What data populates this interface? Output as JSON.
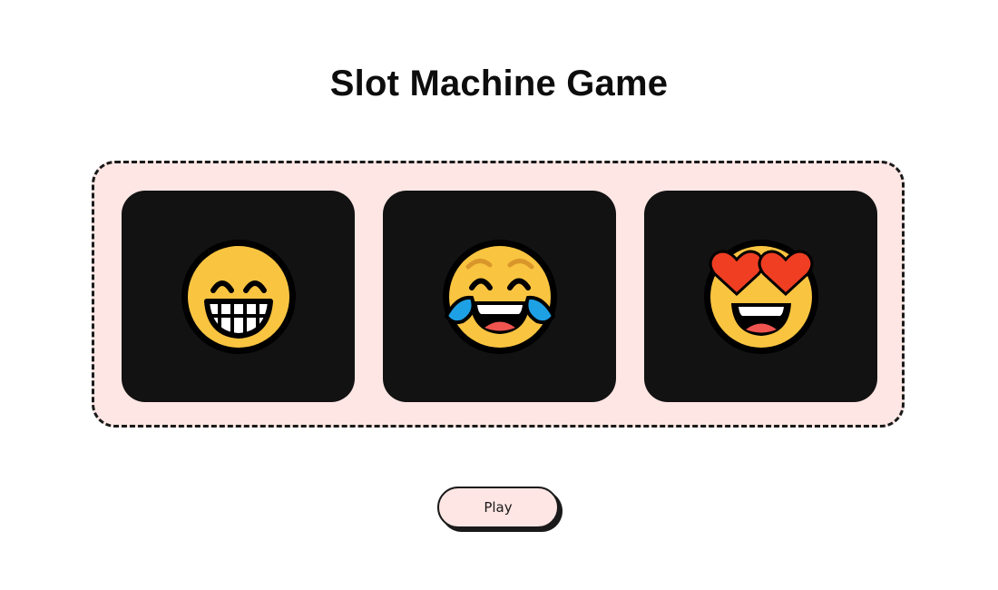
{
  "game": {
    "title": "Slot Machine Game",
    "play_label": "Play"
  },
  "reels": [
    {
      "symbol": "grinning-face-with-smiling-eyes-icon"
    },
    {
      "symbol": "face-with-tears-of-joy-icon"
    },
    {
      "symbol": "smiling-face-with-heart-eyes-icon"
    }
  ],
  "colors": {
    "background": "#ffffff",
    "machine_background": "#fde6e3",
    "machine_border": "#1a1a1a",
    "reel_background": "#121212",
    "emoji_yellow": "#f9c440",
    "tear_blue": "#1ea0e4",
    "heart_red": "#ef3e22",
    "button_background": "#fde6e3"
  }
}
